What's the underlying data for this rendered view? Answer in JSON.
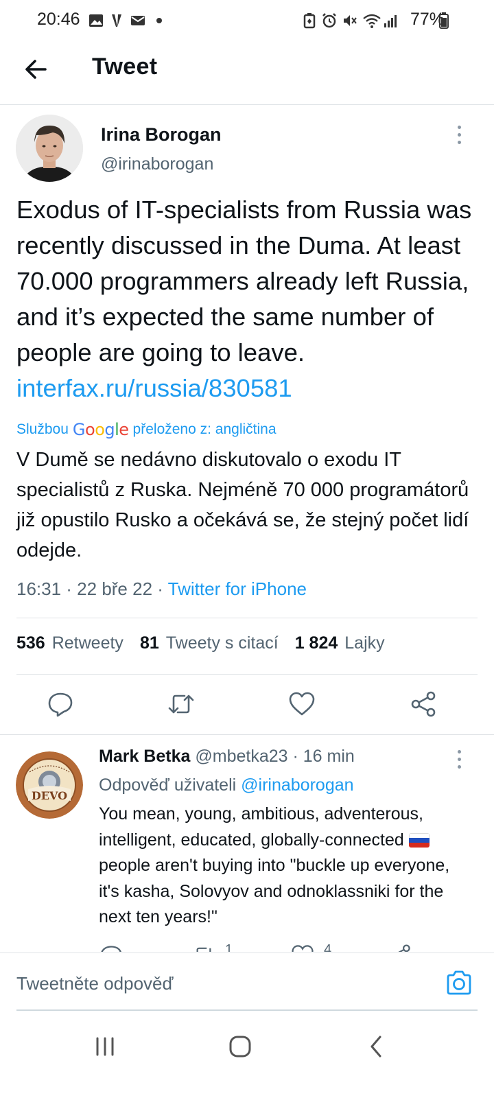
{
  "status_bar": {
    "time": "20:46",
    "battery": "77%",
    "left_icons": [
      "image-icon",
      "v-app-icon",
      "mail-icon",
      "dot-icon"
    ],
    "right_icons": [
      "battery-saver-icon",
      "alarm-icon",
      "mute-icon",
      "wifi-icon",
      "signal-icon",
      "battery-icon"
    ]
  },
  "header": {
    "title": "Tweet",
    "back_icon": "arrow-left-icon"
  },
  "tweet": {
    "author_name": "Irina Borogan",
    "author_handle": "@irinaborogan",
    "text_plain": "Exodus of IT-specialists from Russia was recently discussed in the Duma. At least 70.000 programmers already left Russia, and it’s expected the same number of people are going to leave. ",
    "text_link": "interfax.ru/russia/830581",
    "translation": {
      "prefix": "Službou",
      "brand": "Google",
      "suffix": "přeloženo z: angličtina",
      "text": "V Dumě se nedávno diskutovalo o exodu IT specialistů z Ruska. Nejméně 70 000 programátorů již opustilo Rusko a očekává se, že stejný počet lidí odejde."
    },
    "meta_time": "16:31 · 22 bře 22 · ",
    "meta_source": "Twitter for iPhone",
    "stats": {
      "retweets_count": "536",
      "retweets_label": "Retweety",
      "quotes_count": "81",
      "quotes_label": "Tweety s citací",
      "likes_count": "1 824",
      "likes_label": "Lajky"
    },
    "actions": [
      "reply-icon",
      "retweet-icon",
      "like-icon",
      "share-icon"
    ]
  },
  "reply": {
    "author_name": "Mark Betka",
    "author_handle": "@mbetka23",
    "time": "16 min",
    "reply_to_label": "Odpověď uživateli",
    "reply_to_handle": "@irinaborogan",
    "text_part1": "You mean, young, ambitious, adventerous, intelligent, educated, globally-connected",
    "text_part2": "people aren't buying into \"buckle up everyone, it's kasha, Solovyov and odnoklassniki for the next ten years!\"",
    "avatar_text": "DEVO",
    "retweet_count": "1",
    "like_count": "4"
  },
  "composer": {
    "placeholder": "Tweetněte odpověď"
  },
  "colors": {
    "accent": "#1d9bf0",
    "text": "#0f1419",
    "muted": "#536471",
    "divider": "#dfe3e6"
  }
}
